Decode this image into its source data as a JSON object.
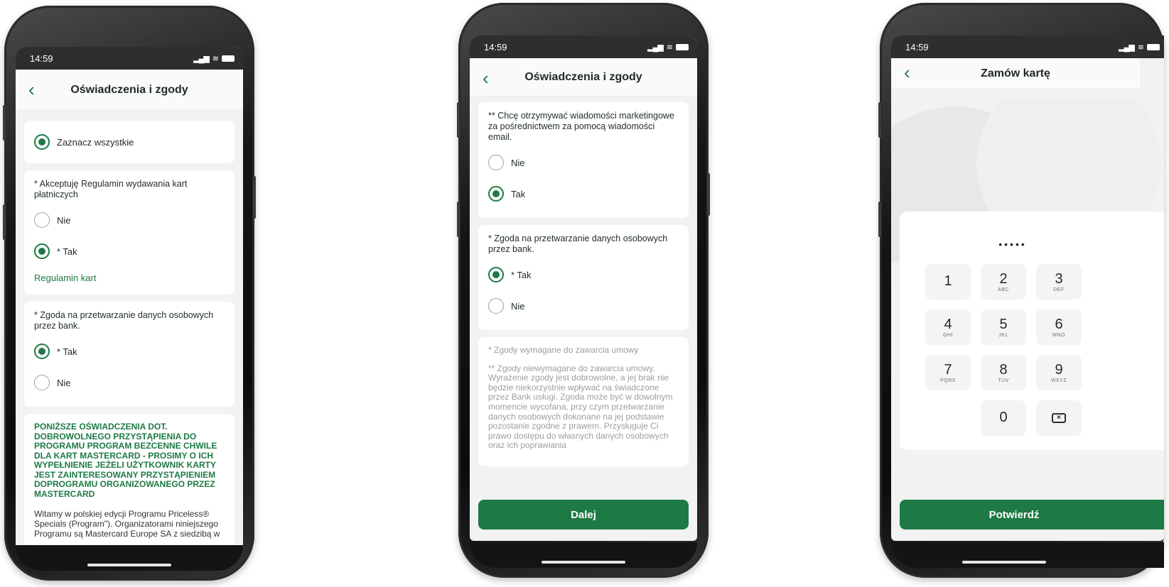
{
  "status_time": "14:59",
  "phone1": {
    "title": "Oświadczenia i zgody",
    "select_all": "Zaznacz wszystkie",
    "q1": "* Akceptuję Regulamin wydawania kart płatniczych",
    "q1_no": "Nie",
    "q1_yes": "* Tak",
    "q1_link": "Regulamin kart",
    "q2": "* Zgoda na przetwarzanie danych osobowych przez bank.",
    "q2_yes": "* Tak",
    "q2_no": "Nie",
    "heading": "PONIŻSZE OŚWIADCZENIA DOT. DOBROWOLNEGO PRZYSTĄPIENIA DO PROGRAMU PROGRAM BEZCENNE CHWILE DLA KART MASTERCARD - PROSIMY O ICH WYPEŁNIENIE JEŻELI UŻYTKOWNIK KARTY JEST ZAINTERESOWANY PRZYSTĄPIENIEM DOPROGRAMU ORGANIZOWANEGO PRZEZ MASTERCARD",
    "body": "Witamy w polskiej edycji Programu Priceless® Specials (Program\"). Organizatorami niniejszego Programu są Mastercard Europe SA z siedzibą w"
  },
  "phone2": {
    "title": "Oświadczenia i zgody",
    "q1": "** Chcę otrzymywać wiadomości marketingowe za pośrednictwem za pomocą wiadomości email.",
    "q1_no": "Nie",
    "q1_yes": "Tak",
    "q2": "* Zgoda na przetwarzanie danych osobowych przez bank.",
    "q2_yes": "* Tak",
    "q2_no": "Nie",
    "note1": "* Zgody wymagane do zawarcia umowy",
    "note2": "** Zgody niewymagane do zawarcia umowy. Wyrażenie zgody jest dobrowolne, a jej brak nie będzie niekorzystnie wpływać na świadczone przez Bank usługi. Zgoda może być w dowolnym momencie wycofana, przy czym przetwarzanie danych osobowych dokonane na jej podstawie pozostanie zgodne z prawem. Przysługuje Ci prawo dostępu do własnych danych osobowych oraz ich poprawiania",
    "button": "Dalej"
  },
  "phone3": {
    "title": "Zamów kartę",
    "pin": "•••••",
    "keys": [
      {
        "d": "1",
        "l": ""
      },
      {
        "d": "2",
        "l": "ABC"
      },
      {
        "d": "3",
        "l": "DEF"
      },
      {
        "d": "4",
        "l": "GHI"
      },
      {
        "d": "5",
        "l": "JKL"
      },
      {
        "d": "6",
        "l": "MNO"
      },
      {
        "d": "7",
        "l": "PQRS"
      },
      {
        "d": "8",
        "l": "TUV"
      },
      {
        "d": "9",
        "l": "WXYZ"
      },
      {
        "d": "0",
        "l": ""
      }
    ],
    "button": "Potwierdź"
  },
  "icons": {
    "back": "chevron-left-icon",
    "signal": "signal-icon",
    "wifi": "wifi-icon",
    "battery": "battery-icon",
    "delete": "backspace-icon"
  },
  "colors": {
    "accent": "#1d7a45",
    "status_bar": "#2e2e2e",
    "background": "#f1f2f1"
  }
}
